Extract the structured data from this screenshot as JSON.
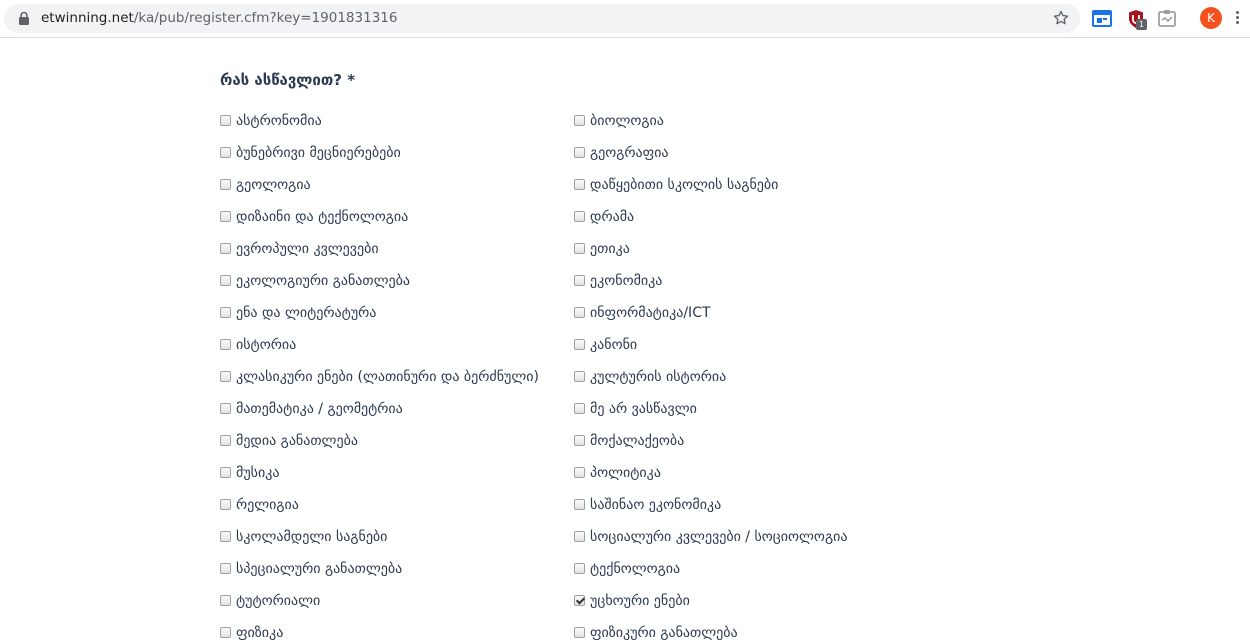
{
  "browser": {
    "url_host": "etwinning.net",
    "url_path": "/ka/pub/register.cfm?key=1901831316",
    "profile_initial": "K",
    "extension_badge": "1"
  },
  "form": {
    "question": "რას ასწავლით? *",
    "left_options": [
      {
        "label": "ასტრონომია",
        "checked": false
      },
      {
        "label": "ბუნებრივი მეცნიერებები",
        "checked": false
      },
      {
        "label": "გეოლოგია",
        "checked": false
      },
      {
        "label": "დიზაინი და ტექნოლოგია",
        "checked": false
      },
      {
        "label": "ევროპული კვლევები",
        "checked": false
      },
      {
        "label": "ეკოლოგიური განათლება",
        "checked": false
      },
      {
        "label": "ენა და ლიტერატურა",
        "checked": false
      },
      {
        "label": "ისტორია",
        "checked": false
      },
      {
        "label": "კლასიკური ენები (ლათინური და ბერძნული)",
        "checked": false
      },
      {
        "label": "მათემატიკა / გეომეტრია",
        "checked": false
      },
      {
        "label": "მედია განათლება",
        "checked": false
      },
      {
        "label": "მუსიკა",
        "checked": false
      },
      {
        "label": "რელიგია",
        "checked": false
      },
      {
        "label": "სკოლამდელი საგნები",
        "checked": false
      },
      {
        "label": "სპეციალური განათლება",
        "checked": false
      },
      {
        "label": "ტუტორიალი",
        "checked": false
      },
      {
        "label": "ფიზიკა",
        "checked": false
      }
    ],
    "right_options": [
      {
        "label": "ბიოლოგია",
        "checked": false
      },
      {
        "label": "გეოგრაფია",
        "checked": false
      },
      {
        "label": "დაწყებითი სკოლის საგნები",
        "checked": false
      },
      {
        "label": "დრამა",
        "checked": false
      },
      {
        "label": "ეთიკა",
        "checked": false
      },
      {
        "label": "ეკონომიკა",
        "checked": false
      },
      {
        "label": "ინფორმატიკა/ICT",
        "checked": false
      },
      {
        "label": "კანონი",
        "checked": false
      },
      {
        "label": "კულტურის ისტორია",
        "checked": false
      },
      {
        "label": "მე არ ვასწავლი",
        "checked": false
      },
      {
        "label": "მოქალაქეობა",
        "checked": false
      },
      {
        "label": "პოლიტიკა",
        "checked": false
      },
      {
        "label": "საშინაო ეკონომიკა",
        "checked": false
      },
      {
        "label": "სოციალური კვლევები / სოციოლოგია",
        "checked": false
      },
      {
        "label": "ტექნოლოგია",
        "checked": false
      },
      {
        "label": "უცხოური ენები",
        "checked": true
      },
      {
        "label": "ფიზიკური განათლება",
        "checked": false
      }
    ]
  }
}
